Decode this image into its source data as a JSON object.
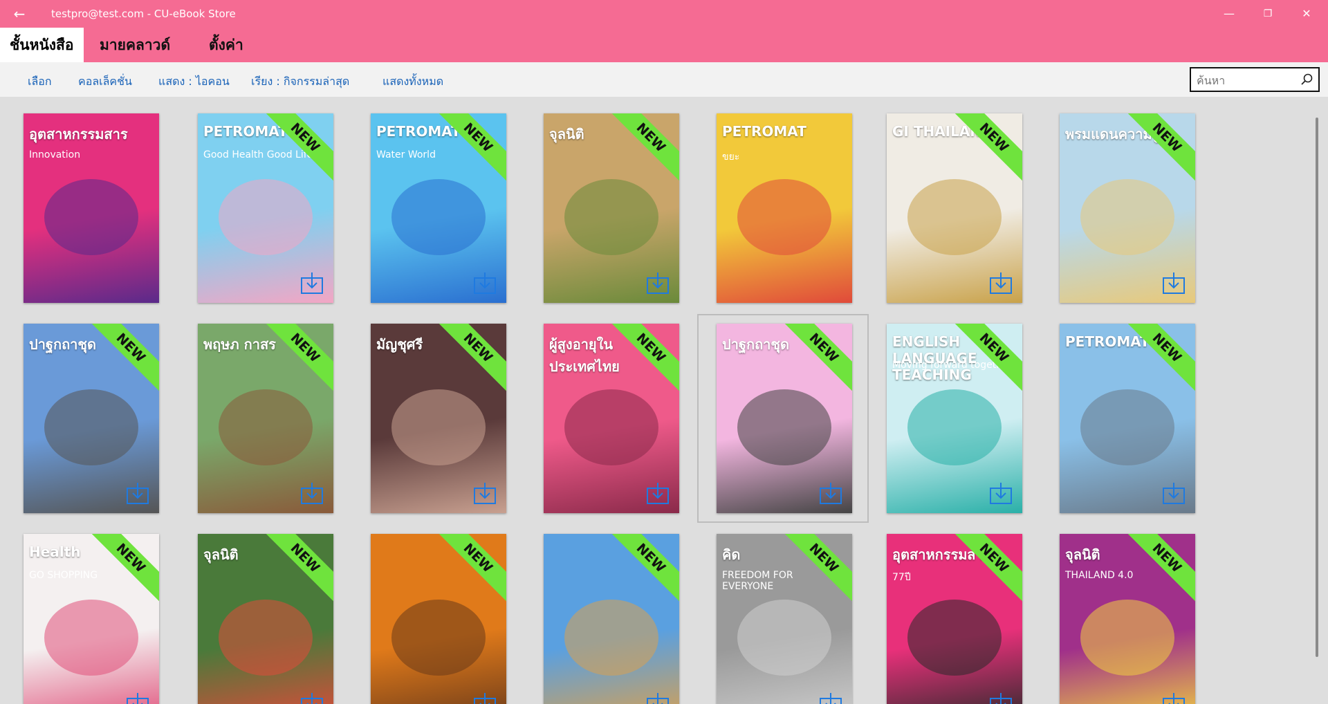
{
  "window": {
    "title": "testpro@test.com - CU-eBook Store",
    "back_icon": "←",
    "minimize_icon": "—",
    "restore_icon": "❐",
    "close_icon": "✕"
  },
  "nav": {
    "tabs": [
      {
        "label": "ชั้นหนังสือ",
        "active": true
      },
      {
        "label": "มายคลาวด์",
        "active": false
      },
      {
        "label": "ตั้งค่า",
        "active": false
      }
    ]
  },
  "toolbar": {
    "select": "เลือก",
    "collection": "คอลเล็คชั่น",
    "view": "แสดง : ไอคอน",
    "sort": "เรียง : กิจกรรมล่าสุด",
    "show_all": "แสดงทั้งหมด"
  },
  "search": {
    "placeholder": "ค้นหา"
  },
  "ribbon_label": "NEW",
  "books": [
    {
      "line1": "อุตสาหกรรมสาร",
      "line2": "Innovation",
      "bg": "#e4307e",
      "accent": "#5a2a8a",
      "new": false
    },
    {
      "line1": "PETROMAT",
      "line2": "Good Health Good Life",
      "bg": "#7fd0f0",
      "accent": "#f3a6c4",
      "new": true
    },
    {
      "line1": "PETROMAT",
      "line2": "Water World",
      "bg": "#5bc3ef",
      "accent": "#2a6fd0",
      "new": true
    },
    {
      "line1": "จุลนิติ",
      "line2": "",
      "bg": "#c9a56a",
      "accent": "#6a8a3a",
      "new": true
    },
    {
      "line1": "PETROMAT",
      "line2": "ขยะ",
      "bg": "#f2c93a",
      "accent": "#e04a3a",
      "new": false
    },
    {
      "line1": "GI THAILAND",
      "line2": "",
      "bg": "#f0ece4",
      "accent": "#c9a24a",
      "new": true
    },
    {
      "line1": "พรมแดนความรู้",
      "line2": "",
      "bg": "#b8d8ea",
      "accent": "#e8c97a",
      "new": true
    },
    {
      "line1": "ปาฐกถาชุด",
      "line2": "",
      "bg": "#6a9ad8",
      "accent": "#555555",
      "new": true
    },
    {
      "line1": "พฤษภ กาสร",
      "line2": "",
      "bg": "#7aa86a",
      "accent": "#8a5a3a",
      "new": true
    },
    {
      "line1": "มัญชุศรี",
      "line2": "",
      "bg": "#5a3a3a",
      "accent": "#c8a090",
      "new": true
    },
    {
      "line1": "ผู้สูงอายุในประเทศไทย",
      "line2": "",
      "bg": "#ef5a8a",
      "accent": "#8a2a4a",
      "new": true
    },
    {
      "line1": "ปาฐกถาชุด",
      "line2": "",
      "bg": "#f3b6e0",
      "accent": "#444444",
      "new": true
    },
    {
      "line1": "ENGLISH LANGUAGE TEACHING",
      "line2": "Moving forward together",
      "bg": "#cfeef2",
      "accent": "#2ab0a8",
      "new": true
    },
    {
      "line1": "PETROMAT",
      "line2": "",
      "bg": "#8ac0e8",
      "accent": "#6a7a8a",
      "new": true
    },
    {
      "line1": "Health",
      "line2": "GO SHOPPING",
      "bg": "#f4f0f0",
      "accent": "#e0507a",
      "new": true
    },
    {
      "line1": "จุลนิติ",
      "line2": "",
      "bg": "#4a7a3a",
      "accent": "#e04a3a",
      "new": true
    },
    {
      "line1": "",
      "line2": "",
      "bg": "#e07a1a",
      "accent": "#6a3a1a",
      "new": true
    },
    {
      "line1": "",
      "line2": "",
      "bg": "#5aa0e0",
      "accent": "#d8a050",
      "new": true
    },
    {
      "line1": "คิด",
      "line2": "FREEDOM FOR EVERYONE",
      "bg": "#9a9a9a",
      "accent": "#cfcfcf",
      "new": true
    },
    {
      "line1": "อุตสาหกรรมสาร",
      "line2": "77ปี",
      "bg": "#e8307a",
      "accent": "#2a2a2a",
      "new": true
    },
    {
      "line1": "จุลนิติ",
      "line2": "THAILAND 4.0",
      "bg": "#a0308a",
      "accent": "#f0d040",
      "new": true
    }
  ]
}
